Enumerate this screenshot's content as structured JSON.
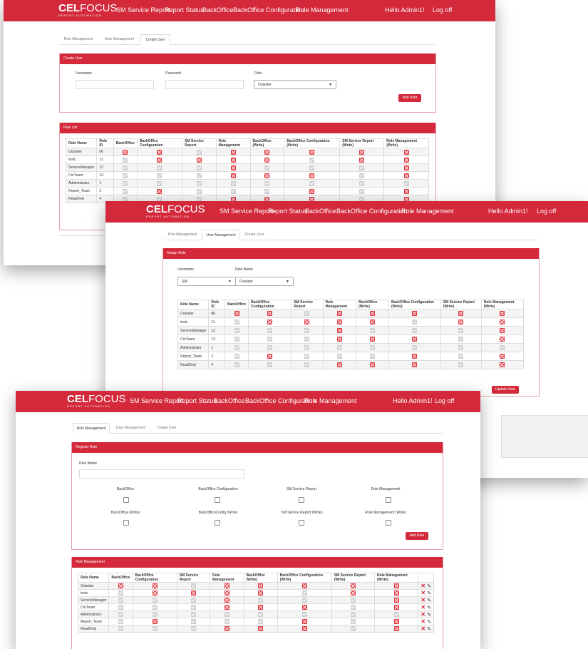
{
  "nav": {
    "brand_main_bold": "CEL",
    "brand_main": "FOCUS",
    "brand_sub": "REPORT AUTOMATION",
    "items": [
      "SM Service Report",
      "Report Status",
      "BackOffice",
      "BackOffice Configuration",
      "Role Management"
    ],
    "greeting": "Hello Admin1!",
    "logoff": "Log off"
  },
  "tabs": [
    "Role Management",
    "User Management",
    "Create User"
  ],
  "columns": [
    "Role Name",
    "Role ID",
    "BackOffice",
    "BackOffice Configuration",
    "SM Service Report",
    "Role Management",
    "BackOffice (Write)",
    "BackOffice Configuration (Write)",
    "SM Service Report (Write)",
    "Role Management (Write)"
  ],
  "roles": [
    {
      "name": "Outsider",
      "id": "86",
      "perms": [
        1,
        1,
        0,
        1,
        1,
        1,
        1,
        1
      ]
    },
    {
      "name": "testc",
      "id": "11",
      "perms": [
        0,
        1,
        1,
        1,
        1,
        0,
        1,
        1
      ]
    },
    {
      "name": "ServiceManager",
      "id": "12",
      "perms": [
        0,
        0,
        0,
        1,
        0,
        0,
        0,
        1
      ]
    },
    {
      "name": "CrnTeam",
      "id": "13",
      "perms": [
        0,
        0,
        0,
        1,
        1,
        1,
        0,
        1
      ]
    },
    {
      "name": "Administrator",
      "id": "1",
      "perms": [
        0,
        0,
        0,
        0,
        0,
        0,
        0,
        0
      ]
    },
    {
      "name": "Report_Team",
      "id": "2",
      "perms": [
        0,
        1,
        0,
        0,
        0,
        1,
        0,
        1
      ]
    },
    {
      "name": "ReadOnly",
      "id": "4",
      "perms": [
        0,
        0,
        0,
        1,
        1,
        1,
        0,
        1
      ]
    }
  ],
  "create_user": {
    "panel_title": "Create User",
    "username_label": "Username",
    "password_label": "Password",
    "role_label": "Role",
    "role_value": "Outsider",
    "add_button": "Add User",
    "role_list_title": "Role List"
  },
  "assign_role": {
    "panel_title": "Assign Role",
    "username_label": "Username",
    "role_name_label": "Role Name",
    "username_value": "SM",
    "role_value": "Outsider",
    "update_button": "Update User"
  },
  "register_role": {
    "panel_title": "Register Role",
    "role_name_label": "Role Name",
    "checkbox_labels": [
      "BackOffice",
      "BackOffice Configuration",
      "SM Service Report",
      "Role Management",
      "BackOffice (Write)",
      "BackOfficeConfig (Write)",
      "SM Service Report (Write)",
      "Role Management (Write)"
    ],
    "add_button": "Add Role",
    "table_title": "Role Management"
  },
  "colors": {
    "brand_red": "#d3293a",
    "deny_red": "#e3353f",
    "allow_grey": "#d0d0d0"
  },
  "icons": {
    "deny": "x-icon",
    "allow": "check-icon",
    "delete": "delete-icon",
    "edit": "pencil-icon",
    "dropdown": "chevron-down-icon"
  }
}
